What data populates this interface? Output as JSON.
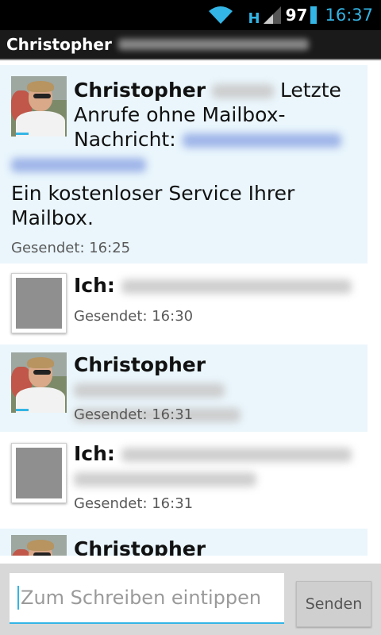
{
  "status_bar": {
    "network": "H",
    "battery": "97",
    "time": "16:37",
    "accent": "#33b5e5"
  },
  "header": {
    "contact_name": "Christopher"
  },
  "messages": [
    {
      "direction": "incoming",
      "sender": "Christopher",
      "text_part1": "Letzte Anrufe ohne Mailbox-Nachricht:",
      "text_part2": "Ein kostenloser Service Ihrer Mailbox.",
      "sent": "Gesendet: 16:25"
    },
    {
      "direction": "outgoing",
      "sender": "Ich:",
      "sent": "Gesendet: 16:30"
    },
    {
      "direction": "incoming",
      "sender": "Christopher",
      "sent": "Gesendet: 16:31"
    },
    {
      "direction": "outgoing",
      "sender": "Ich:",
      "sent": "Gesendet: 16:31"
    },
    {
      "direction": "incoming",
      "sender": "Christopher"
    }
  ],
  "compose": {
    "placeholder": "Zum Schreiben eintippen",
    "send_label": "Senden"
  }
}
